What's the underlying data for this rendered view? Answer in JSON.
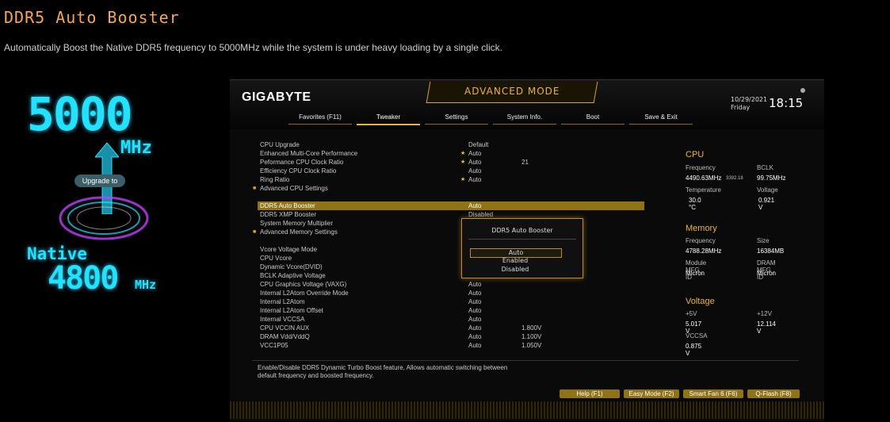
{
  "page": {
    "title": "DDR5 Auto Booster",
    "subtitle": "Automatically Boost the Native DDR5 frequency to 5000MHz while the system is under heavy loading by a single click."
  },
  "promo": {
    "top_value": "5000",
    "top_unit": "MHz",
    "badge": "Upgrade to",
    "native_label": "Native",
    "bottom_value": "4800",
    "bottom_unit": "MHz"
  },
  "bios": {
    "logo": "GIGABYTE",
    "mode": "ADVANCED MODE",
    "date": "10/29/2021",
    "day": "Friday",
    "time": "18:15",
    "tabs": [
      {
        "label": "Favorites (F11)"
      },
      {
        "label": "Tweaker"
      },
      {
        "label": "Settings"
      },
      {
        "label": "System Info."
      },
      {
        "label": "Boot"
      },
      {
        "label": "Save & Exit"
      }
    ],
    "settings": [
      {
        "label": "CPU Upgrade",
        "value": "Default",
        "value2": ""
      },
      {
        "label": "Enhanced Multi-Core Performance",
        "value": "Auto",
        "value2": ""
      },
      {
        "label": "Peformance CPU Clock Ratio",
        "value": "Auto",
        "value2": "21"
      },
      {
        "label": "Efficiency CPU Clock Ratio",
        "value": "Auto",
        "value2": ""
      },
      {
        "label": "Ring Ratio",
        "value": "Auto",
        "value2": ""
      },
      {
        "label": "Advanced CPU Settings",
        "value": "",
        "value2": ""
      },
      {
        "label": "DDR5 Auto Booster",
        "value": "Auto",
        "value2": ""
      },
      {
        "label": "DDR5 XMP Booster",
        "value": "Disabled",
        "value2": ""
      },
      {
        "label": "System Memory Multiplier",
        "value": "",
        "value2": ""
      },
      {
        "label": "Advanced Memory Settings",
        "value": "",
        "value2": ""
      },
      {
        "label": "Vcore Voltage Mode",
        "value": "",
        "value2": ""
      },
      {
        "label": "CPU Vcore",
        "value": "",
        "value2": ""
      },
      {
        "label": "Dynamic Vcore(DVID)",
        "value": "",
        "value2": ""
      },
      {
        "label": "BCLK Adaptive Voltage",
        "value": "",
        "value2": ""
      },
      {
        "label": "CPU Graphics Voltage (VAXG)",
        "value": "Auto",
        "value2": ""
      },
      {
        "label": "Internal L2Atom Override Mode",
        "value": "Auto",
        "value2": ""
      },
      {
        "label": "Internal L2Atom",
        "value": "Auto",
        "value2": ""
      },
      {
        "label": "Internal L2Atom Offset",
        "value": "Auto",
        "value2": ""
      },
      {
        "label": "Internal VCCSA",
        "value": "Auto",
        "value2": ""
      },
      {
        "label": "CPU VCCIN AUX",
        "value": "Auto",
        "value2": "1.800V"
      },
      {
        "label": "DRAM Vdd/VddQ",
        "value": "Auto",
        "value2": "1.100V"
      },
      {
        "label": "VCC1P05",
        "value": "Auto",
        "value2": "1.050V"
      }
    ],
    "popup": {
      "title": "DDR5 Auto Booster",
      "options": [
        "Auto",
        "Enabled",
        "Disabled"
      ]
    },
    "cpu": {
      "heading": "CPU",
      "freq_label": "Frequency",
      "freq_value": "4490.63MHz",
      "freq_sub": "3392.18",
      "bclk_label": "BCLK",
      "bclk_value": "99.75MHz",
      "temp_label": "Temperature",
      "temp_value": "30.0 °C",
      "volt_label": "Voltage",
      "volt_value": "0.921 V"
    },
    "memory": {
      "heading": "Memory",
      "freq_label": "Frequency",
      "freq_value": "4788.28MHz",
      "size_label": "Size",
      "size_value": "16384MB",
      "mod_label": "Module MFG ID",
      "mod_value": "Micron",
      "dram_label": "DRAM MFG ID",
      "dram_value": "Micron"
    },
    "voltage": {
      "heading": "Voltage",
      "v5_label": "+5V",
      "v5_value": "5.017 V",
      "v12_label": "+12V",
      "v12_value": "12.114 V",
      "vccsa_label": "VCCSA",
      "vccsa_value": "0.875 V"
    },
    "help_text": "Enable/Disable DDR5 Dynamic Turbo Boost feature, Allows automatic switching between default frequency and boosted frequency.",
    "buttons": [
      {
        "label": "Help (F1)"
      },
      {
        "label": "Easy Mode (F2)"
      },
      {
        "label": "Smart Fan 6 (F6)"
      },
      {
        "label": "Q-Flash (F8)"
      }
    ]
  },
  "colors": {
    "accent": "#e9b43c",
    "title": "#f3a65e",
    "neon": "#22e2ff"
  }
}
